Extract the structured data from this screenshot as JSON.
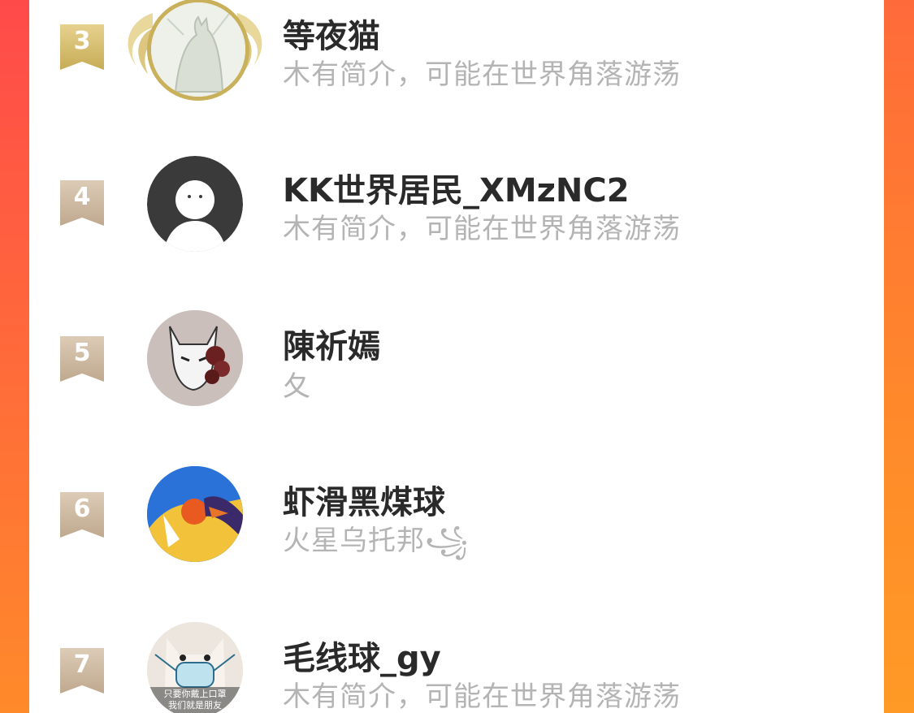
{
  "ranking": {
    "entries": [
      {
        "rank": "3",
        "name": "等夜猫",
        "bio": "木有简介，可能在世界角落游荡",
        "avatar_icon": "cat-sketch-avatar-icon",
        "badge": "gold-wings"
      },
      {
        "rank": "4",
        "name": "KK世界居民_XMzNC2",
        "bio": "木有简介，可能在世界角落游荡",
        "avatar_icon": "default-person-avatar-icon"
      },
      {
        "rank": "5",
        "name": "陳祈嫣",
        "bio": "夂",
        "avatar_icon": "fox-mask-avatar-icon"
      },
      {
        "rank": "6",
        "name": "虾滑黑煤球",
        "bio": "火星乌托邦꧁",
        "avatar_icon": "anime-character-avatar-icon"
      },
      {
        "rank": "7",
        "name": "毛线球_gy",
        "bio": "木有简介，可能在世界角落游荡",
        "avatar_icon": "masked-cat-avatar-icon",
        "avatar_caption_1": "只要你戴上口罩",
        "avatar_caption_2": "我们就是朋友"
      }
    ]
  },
  "colors": {
    "background_gradient_top": "#ff4a4a",
    "background_gradient_bottom": "#ff8a2a",
    "gold": "#c9b15c",
    "name_text": "#2a2a2a",
    "bio_text": "#b4b4b4"
  }
}
